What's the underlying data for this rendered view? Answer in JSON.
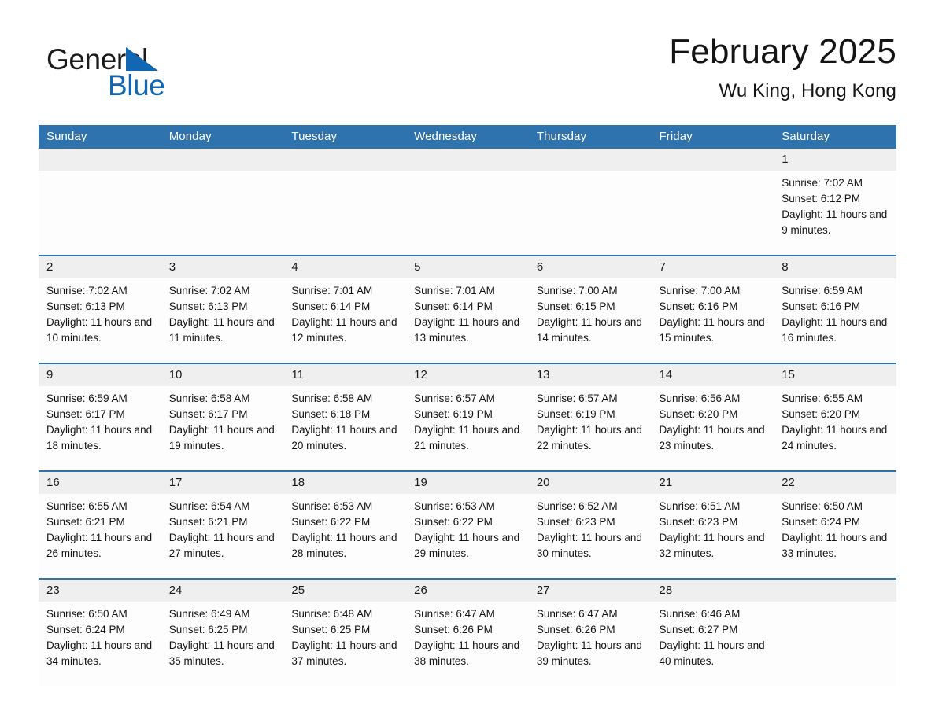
{
  "logo": {
    "word_top": "General",
    "word_bottom": "Blue",
    "triangle_color": "#1267b2",
    "icon": "triangle-icon"
  },
  "header": {
    "title": "February 2025",
    "subtitle": "Wu King, Hong Kong"
  },
  "colors": {
    "header_blue": "#2e72ae",
    "daynum_gray": "#efefef",
    "text": "#141414"
  },
  "calendar": {
    "weekday_headers": [
      "Sunday",
      "Monday",
      "Tuesday",
      "Wednesday",
      "Thursday",
      "Friday",
      "Saturday"
    ],
    "weeks": [
      [
        {
          "day": "",
          "blank": true
        },
        {
          "day": "",
          "blank": true
        },
        {
          "day": "",
          "blank": true
        },
        {
          "day": "",
          "blank": true
        },
        {
          "day": "",
          "blank": true
        },
        {
          "day": "",
          "blank": true
        },
        {
          "day": "1",
          "sunrise": "Sunrise: 7:02 AM",
          "sunset": "Sunset: 6:12 PM",
          "daylight": "Daylight: 11 hours and 9 minutes."
        }
      ],
      [
        {
          "day": "2",
          "sunrise": "Sunrise: 7:02 AM",
          "sunset": "Sunset: 6:13 PM",
          "daylight": "Daylight: 11 hours and 10 minutes."
        },
        {
          "day": "3",
          "sunrise": "Sunrise: 7:02 AM",
          "sunset": "Sunset: 6:13 PM",
          "daylight": "Daylight: 11 hours and 11 minutes."
        },
        {
          "day": "4",
          "sunrise": "Sunrise: 7:01 AM",
          "sunset": "Sunset: 6:14 PM",
          "daylight": "Daylight: 11 hours and 12 minutes."
        },
        {
          "day": "5",
          "sunrise": "Sunrise: 7:01 AM",
          "sunset": "Sunset: 6:14 PM",
          "daylight": "Daylight: 11 hours and 13 minutes."
        },
        {
          "day": "6",
          "sunrise": "Sunrise: 7:00 AM",
          "sunset": "Sunset: 6:15 PM",
          "daylight": "Daylight: 11 hours and 14 minutes."
        },
        {
          "day": "7",
          "sunrise": "Sunrise: 7:00 AM",
          "sunset": "Sunset: 6:16 PM",
          "daylight": "Daylight: 11 hours and 15 minutes."
        },
        {
          "day": "8",
          "sunrise": "Sunrise: 6:59 AM",
          "sunset": "Sunset: 6:16 PM",
          "daylight": "Daylight: 11 hours and 16 minutes."
        }
      ],
      [
        {
          "day": "9",
          "sunrise": "Sunrise: 6:59 AM",
          "sunset": "Sunset: 6:17 PM",
          "daylight": "Daylight: 11 hours and 18 minutes."
        },
        {
          "day": "10",
          "sunrise": "Sunrise: 6:58 AM",
          "sunset": "Sunset: 6:17 PM",
          "daylight": "Daylight: 11 hours and 19 minutes."
        },
        {
          "day": "11",
          "sunrise": "Sunrise: 6:58 AM",
          "sunset": "Sunset: 6:18 PM",
          "daylight": "Daylight: 11 hours and 20 minutes."
        },
        {
          "day": "12",
          "sunrise": "Sunrise: 6:57 AM",
          "sunset": "Sunset: 6:19 PM",
          "daylight": "Daylight: 11 hours and 21 minutes."
        },
        {
          "day": "13",
          "sunrise": "Sunrise: 6:57 AM",
          "sunset": "Sunset: 6:19 PM",
          "daylight": "Daylight: 11 hours and 22 minutes."
        },
        {
          "day": "14",
          "sunrise": "Sunrise: 6:56 AM",
          "sunset": "Sunset: 6:20 PM",
          "daylight": "Daylight: 11 hours and 23 minutes."
        },
        {
          "day": "15",
          "sunrise": "Sunrise: 6:55 AM",
          "sunset": "Sunset: 6:20 PM",
          "daylight": "Daylight: 11 hours and 24 minutes."
        }
      ],
      [
        {
          "day": "16",
          "sunrise": "Sunrise: 6:55 AM",
          "sunset": "Sunset: 6:21 PM",
          "daylight": "Daylight: 11 hours and 26 minutes."
        },
        {
          "day": "17",
          "sunrise": "Sunrise: 6:54 AM",
          "sunset": "Sunset: 6:21 PM",
          "daylight": "Daylight: 11 hours and 27 minutes."
        },
        {
          "day": "18",
          "sunrise": "Sunrise: 6:53 AM",
          "sunset": "Sunset: 6:22 PM",
          "daylight": "Daylight: 11 hours and 28 minutes."
        },
        {
          "day": "19",
          "sunrise": "Sunrise: 6:53 AM",
          "sunset": "Sunset: 6:22 PM",
          "daylight": "Daylight: 11 hours and 29 minutes."
        },
        {
          "day": "20",
          "sunrise": "Sunrise: 6:52 AM",
          "sunset": "Sunset: 6:23 PM",
          "daylight": "Daylight: 11 hours and 30 minutes."
        },
        {
          "day": "21",
          "sunrise": "Sunrise: 6:51 AM",
          "sunset": "Sunset: 6:23 PM",
          "daylight": "Daylight: 11 hours and 32 minutes."
        },
        {
          "day": "22",
          "sunrise": "Sunrise: 6:50 AM",
          "sunset": "Sunset: 6:24 PM",
          "daylight": "Daylight: 11 hours and 33 minutes."
        }
      ],
      [
        {
          "day": "23",
          "sunrise": "Sunrise: 6:50 AM",
          "sunset": "Sunset: 6:24 PM",
          "daylight": "Daylight: 11 hours and 34 minutes."
        },
        {
          "day": "24",
          "sunrise": "Sunrise: 6:49 AM",
          "sunset": "Sunset: 6:25 PM",
          "daylight": "Daylight: 11 hours and 35 minutes."
        },
        {
          "day": "25",
          "sunrise": "Sunrise: 6:48 AM",
          "sunset": "Sunset: 6:25 PM",
          "daylight": "Daylight: 11 hours and 37 minutes."
        },
        {
          "day": "26",
          "sunrise": "Sunrise: 6:47 AM",
          "sunset": "Sunset: 6:26 PM",
          "daylight": "Daylight: 11 hours and 38 minutes."
        },
        {
          "day": "27",
          "sunrise": "Sunrise: 6:47 AM",
          "sunset": "Sunset: 6:26 PM",
          "daylight": "Daylight: 11 hours and 39 minutes."
        },
        {
          "day": "28",
          "sunrise": "Sunrise: 6:46 AM",
          "sunset": "Sunset: 6:27 PM",
          "daylight": "Daylight: 11 hours and 40 minutes."
        },
        {
          "day": "",
          "blank": true
        }
      ]
    ]
  }
}
